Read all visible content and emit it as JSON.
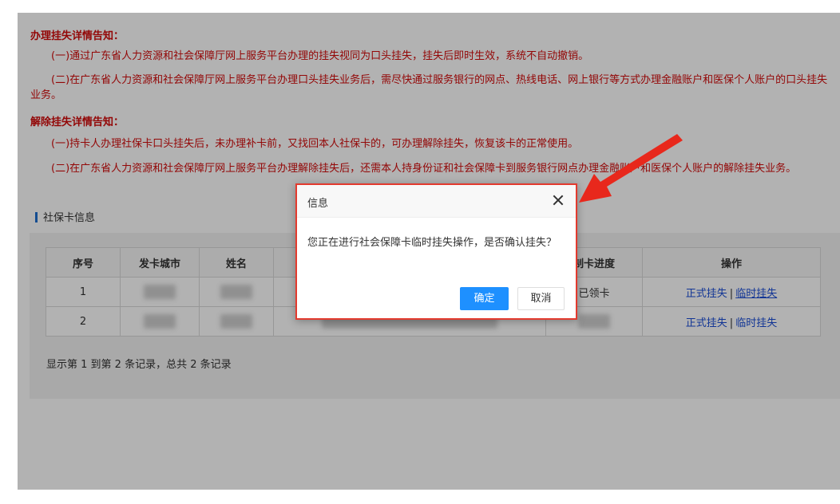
{
  "notice": {
    "report_title": "办理挂失详情告知：",
    "report_p1": "(一)通过广东省人力资源和社会保障厅网上服务平台办理的挂失视同为口头挂失，挂失后即时生效，系统不自动撤销。",
    "report_p2": "(二)在广东省人力资源和社会保障厅网上服务平台办理口头挂失业务后，需尽快通过服务银行的网点、热线电话、网上银行等方式办理金融账户和医保个人账户的口头挂失业务。",
    "release_title": "解除挂失详情告知：",
    "release_p1": "(一)持卡人办理社保卡口头挂失后，未办理补卡前，又找回本人社保卡的，可办理解除挂失，恢复该卡的正常使用。",
    "release_p2": "(二)在广东省人力资源和社会保障厅网上服务平台办理解除挂失后，还需本人持身份证和社会保障卡到服务银行网点办理金融账户和医保个人账户的解除挂失业务。"
  },
  "section": {
    "title": "社保卡信息"
  },
  "table": {
    "headers": [
      "序号",
      "发卡城市",
      "姓名",
      "",
      "制卡进度",
      "操作"
    ],
    "rows": [
      {
        "index": "1",
        "progress": "已领卡",
        "action_formal": "正式挂失",
        "action_temp": "临时挂失"
      },
      {
        "index": "2",
        "progress": "",
        "action_formal": "正式挂失",
        "action_temp": "临时挂失"
      }
    ],
    "separator": "|"
  },
  "pager": {
    "text": "显示第 1 到第 2 条记录，总共 2 条记录"
  },
  "dialog": {
    "title": "信息",
    "message": "您正在进行社会保障卡临时挂失操作，是否确认挂失？",
    "ok_label": "确定",
    "cancel_label": "取消"
  },
  "colors": {
    "notice_red": "#d30b0b",
    "link_blue": "#1a4cd6",
    "primary_button": "#1e90ff",
    "highlight_red": "#e33a2e"
  }
}
